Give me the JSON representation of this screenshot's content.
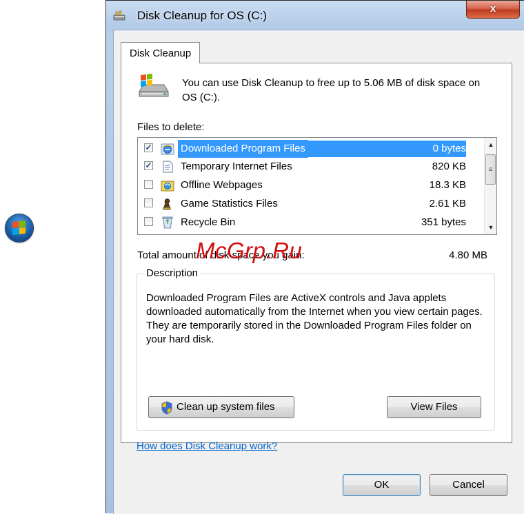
{
  "window": {
    "title": "Disk Cleanup for OS (C:)",
    "close_label": "x"
  },
  "tabs": [
    {
      "label": "Disk Cleanup"
    }
  ],
  "intro_text": "You can use Disk Cleanup to free up to 5.06 MB of disk space on OS (C:).",
  "files_label": "Files to delete:",
  "files": [
    {
      "name": "Downloaded Program Files",
      "size": "0 bytes",
      "checked": true,
      "selected": true,
      "icon": "ie-globe-icon"
    },
    {
      "name": "Temporary Internet Files",
      "size": "820 KB",
      "checked": true,
      "selected": false,
      "icon": "document-icon"
    },
    {
      "name": "Offline Webpages",
      "size": "18.3 KB",
      "checked": false,
      "selected": false,
      "icon": "offline-folder-icon"
    },
    {
      "name": "Game Statistics Files",
      "size": "2.61 KB",
      "checked": false,
      "selected": false,
      "icon": "chess-piece-icon"
    },
    {
      "name": "Recycle Bin",
      "size": "351 bytes",
      "checked": false,
      "selected": false,
      "icon": "recycle-bin-icon"
    }
  ],
  "total_label": "Total amount of disk space you gain:",
  "total_value": "4.80 MB",
  "watermark": "McGrp.Ru",
  "description": {
    "title": "Description",
    "text": "Downloaded Program Files are ActiveX controls and Java applets downloaded automatically from the Internet when you view certain pages. They are temporarily stored in the Downloaded Program Files folder on your hard disk."
  },
  "buttons": {
    "cleanup_system": "Clean up system files",
    "view_files": "View Files",
    "ok": "OK",
    "cancel": "Cancel"
  },
  "help_link": "How does Disk Cleanup work?",
  "colors": {
    "selection": "#3399ff",
    "link": "#0066cc",
    "watermark": "#d01010"
  }
}
